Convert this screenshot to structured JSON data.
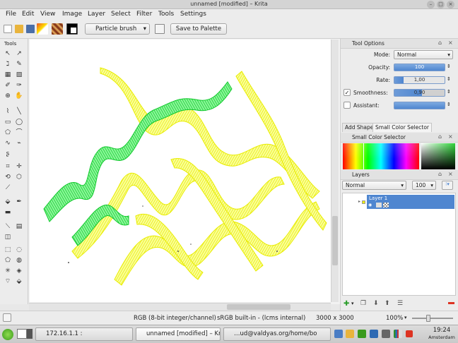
{
  "window": {
    "title": "unnamed [modified] – Krita"
  },
  "menu": [
    "File",
    "Edit",
    "View",
    "Image",
    "Layer",
    "Select",
    "Filter",
    "Tools",
    "Settings"
  ],
  "toolbar": {
    "brush_preset": "Particle brush",
    "save_palette": "Save to Palette"
  },
  "tools_docker": {
    "title": "Tools"
  },
  "tool_options": {
    "title": "Tool Options",
    "mode_label": "Mode:",
    "mode_value": "Normal",
    "opacity_label": "Opacity:",
    "opacity_value": "100",
    "rate_label": "Rate:",
    "rate_value": "1,00",
    "smoothness_label": "Smoothness:",
    "smoothness_value": "0,90",
    "smoothness_checked": true,
    "assistant_label": "Assistant:"
  },
  "tabs": [
    "Add Shape",
    "Small Color Selector"
  ],
  "color_selector": {
    "title": "Small Color Selector"
  },
  "layers": {
    "title": "Layers",
    "blend_mode": "Normal",
    "opacity": "100",
    "items": [
      {
        "name": "Layer 1",
        "selected": true
      }
    ]
  },
  "status": {
    "color_model": "RGB (8-bit integer/channel)",
    "profile": "sRGB built-in - (lcms internal)",
    "image_size": "3000 x 3000",
    "zoom": "100%"
  },
  "taskbar": {
    "task1": "172.16.1.1 :",
    "task2": "unnamed [modified] – Krita",
    "task3": "…ud@valdyas.org/home/bo",
    "clock_time": "19:24",
    "clock_city": "Amsterdam"
  },
  "colors": {
    "accent": "#4a86d4",
    "stroke_green": "#18d43a",
    "stroke_yellow": "#eef000",
    "selection": "#4f86d0"
  }
}
